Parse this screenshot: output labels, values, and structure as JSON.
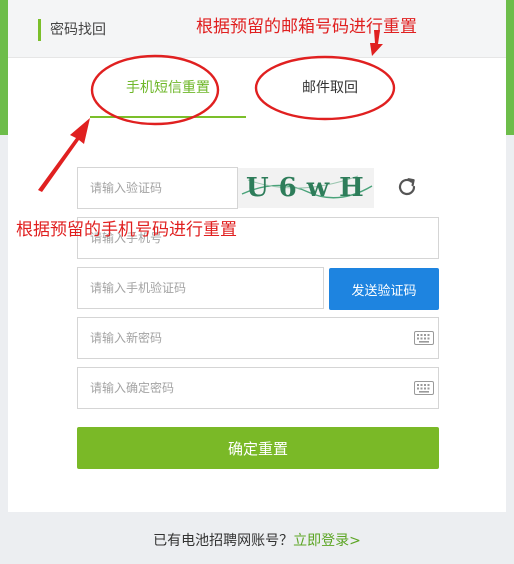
{
  "header": {
    "title": "密码找回"
  },
  "tabs": [
    {
      "label": "手机短信重置",
      "active": true
    },
    {
      "label": "邮件取回",
      "active": false
    }
  ],
  "form": {
    "captcha_placeholder": "请输入验证码",
    "captcha_text": "U6wH",
    "phone_placeholder": "请输入手机号",
    "sms_code_placeholder": "请输入手机验证码",
    "send_code_label": "发送验证码",
    "new_password_placeholder": "请输入新密码",
    "confirm_password_placeholder": "请输入确定密码",
    "submit_label": "确定重置"
  },
  "footer": {
    "prompt": "已有电池招聘网账号？",
    "login_link": "立即登录>"
  },
  "annotations": {
    "email_note": "根据预留的邮箱号码进行重置",
    "phone_note": "根据预留的手机号码进行重置"
  },
  "colors": {
    "brand_green": "#7ab927",
    "send_blue": "#1e84e0",
    "annotation_red": "#e02020"
  }
}
